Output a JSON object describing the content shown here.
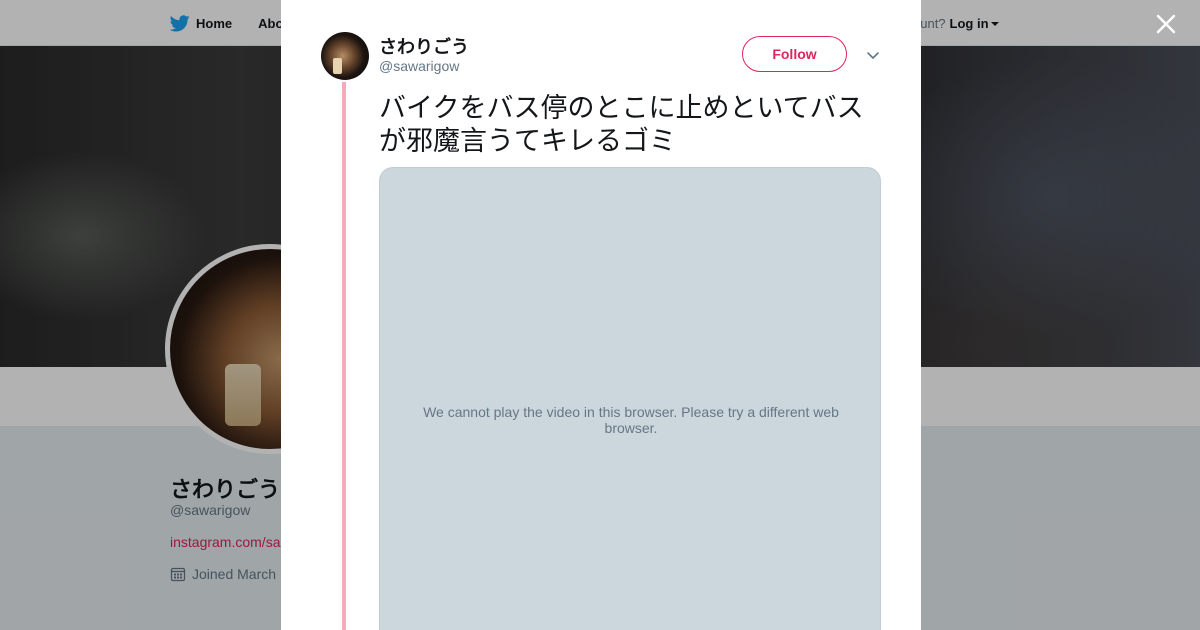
{
  "nav": {
    "home_label": "Home",
    "about_label": "Abo",
    "account_prompt": "ccount?",
    "login_label": "Log in"
  },
  "profile": {
    "name": "さわりごう",
    "handle": "@sawarigow",
    "link": "instagram.com/sa",
    "joined": "Joined March"
  },
  "tweet": {
    "author_name": "さわりごう",
    "author_handle": "@sawarigow",
    "follow_label": "Follow",
    "text": "バイクをバス停のとこに止めといてバスが邪魔言うてキレるゴミ",
    "video_message": "We cannot play the video in this browser. Please try a different web browser."
  },
  "colors": {
    "accent": "#e0245e",
    "thread_line": "#f4aab9",
    "twitter_blue": "#1da1f2",
    "video_bg": "#ccd6dd"
  },
  "icons": {
    "logo": "twitter-bird-icon",
    "close": "close-icon",
    "menu": "chevron-down-icon",
    "calendar": "calendar-icon"
  }
}
